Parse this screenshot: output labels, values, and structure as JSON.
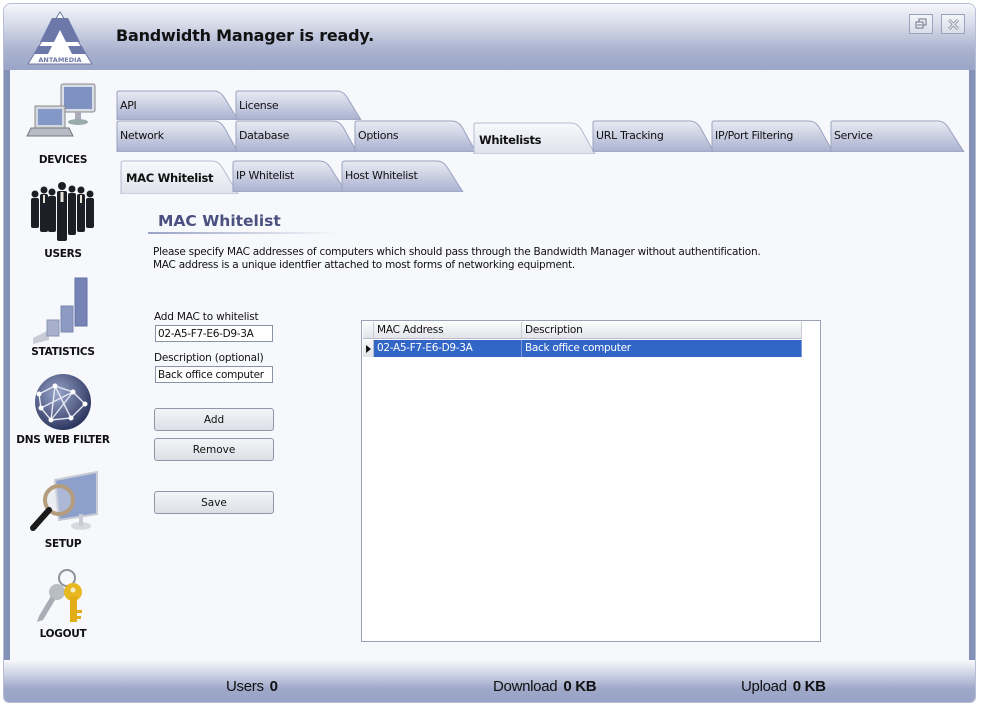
{
  "app": {
    "brand": "ANTAMEDIA",
    "status_title": "Bandwidth Manager is ready.",
    "window_buttons": {
      "restore": "restore-icon",
      "close": "close-icon"
    }
  },
  "sidebar": {
    "items": [
      {
        "label": "DEVICES",
        "icon": "devices-icon"
      },
      {
        "label": "USERS",
        "icon": "users-icon"
      },
      {
        "label": "STATISTICS",
        "icon": "statistics-icon"
      },
      {
        "label": "DNS WEB FILTER",
        "icon": "globe-network-icon"
      },
      {
        "label": "SETUP",
        "icon": "setup-magnifier-icon"
      },
      {
        "label": "LOGOUT",
        "icon": "keys-icon"
      }
    ]
  },
  "tabs": {
    "row1": [
      {
        "label": "API"
      },
      {
        "label": "License"
      }
    ],
    "row2": [
      {
        "label": "Network"
      },
      {
        "label": "Database"
      },
      {
        "label": "Options"
      },
      {
        "label": "Whitelists",
        "active": true
      },
      {
        "label": "URL Tracking"
      },
      {
        "label": "IP/Port Filtering"
      },
      {
        "label": "Service"
      }
    ],
    "subtabs": [
      {
        "label": "MAC Whitelist",
        "active": true
      },
      {
        "label": "IP Whitelist"
      },
      {
        "label": "Host Whitelist"
      }
    ]
  },
  "main": {
    "section_title": "MAC Whitelist",
    "description_line1": "Please specify MAC addresses of computers which should pass through the Bandwidth Manager without authentification.",
    "description_line2": "MAC address is a unique identfier attached to most forms of networking equipment.",
    "form": {
      "mac_label": "Add MAC to whitelist",
      "mac_value": "02-A5-F7-E6-D9-3A",
      "desc_label": "Description (optional)",
      "desc_value": "Back office computer",
      "add_label": "Add",
      "remove_label": "Remove",
      "save_label": "Save"
    },
    "grid": {
      "columns": [
        "MAC Address",
        "Description"
      ],
      "rows": [
        {
          "mac": "02-A5-F7-E6-D9-3A",
          "description": "Back office computer",
          "selected": true
        }
      ]
    }
  },
  "statusbar": {
    "users_label": "Users",
    "users_value": "0",
    "download_label": "Download",
    "download_value": "0 KB",
    "upload_label": "Upload",
    "upload_value": "0 KB"
  },
  "colors": {
    "accent": "#8592b8",
    "selection": "#3165c6",
    "section_title": "#4a5180"
  }
}
